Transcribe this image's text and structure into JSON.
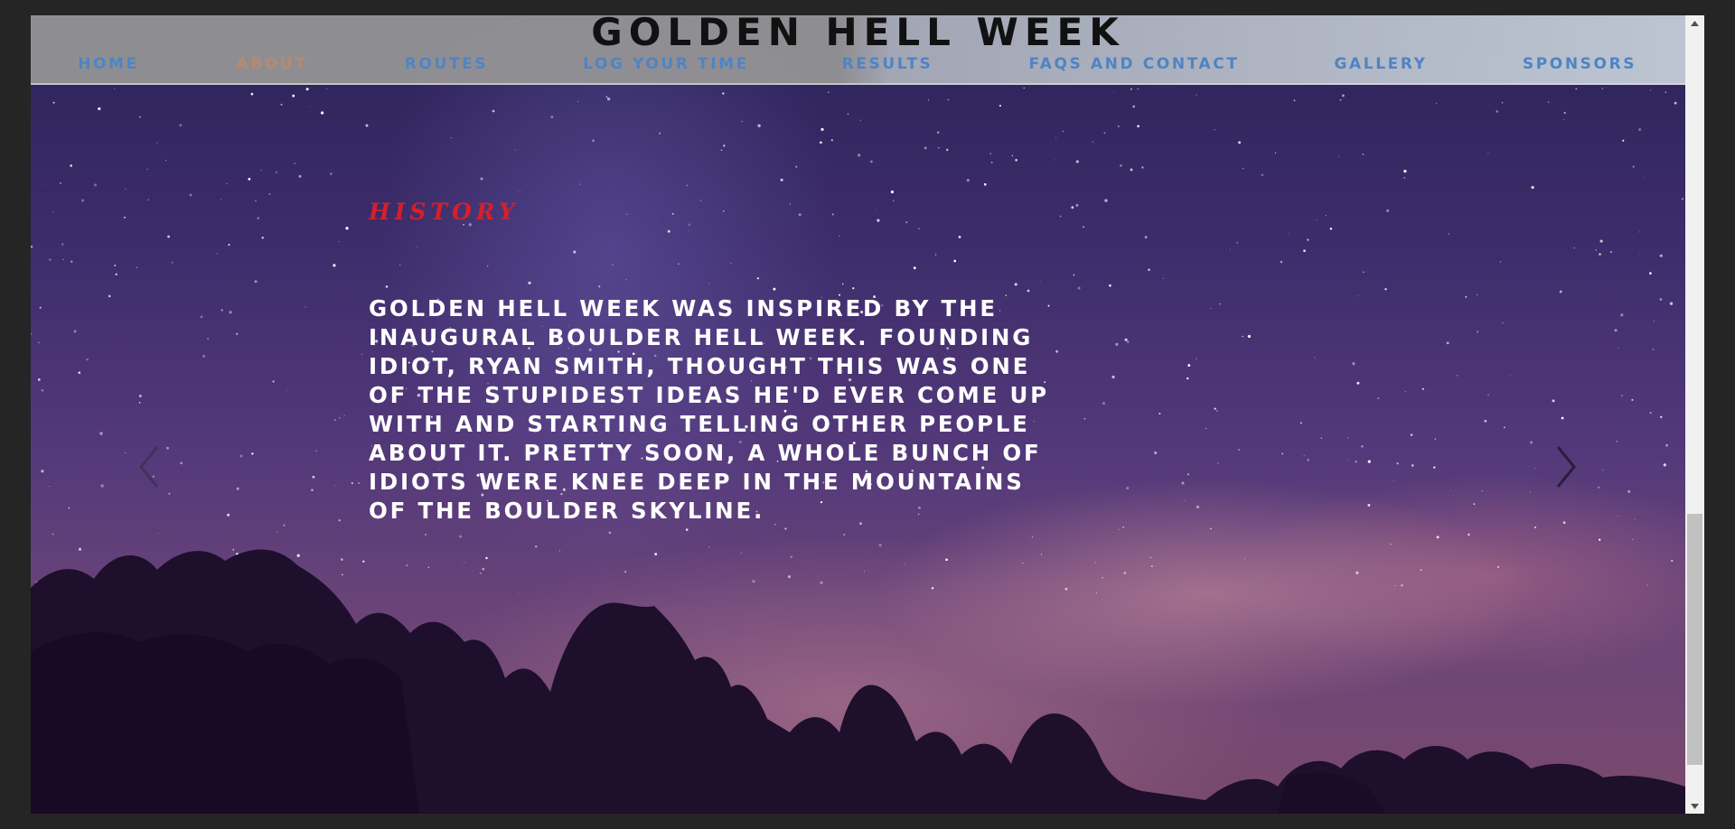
{
  "header": {
    "site_title": "GOLDEN HELL WEEK"
  },
  "nav": {
    "items": [
      {
        "label": "HOME",
        "active": false
      },
      {
        "label": "ABOUT",
        "active": true
      },
      {
        "label": "ROUTES",
        "active": false
      },
      {
        "label": "LOG YOUR TIME",
        "active": false
      },
      {
        "label": "RESULTS",
        "active": false
      },
      {
        "label": "FAQS AND CONTACT",
        "active": false
      },
      {
        "label": "GALLERY",
        "active": false
      },
      {
        "label": "SPONSORS",
        "active": false
      }
    ]
  },
  "slide": {
    "heading": "HISTORY",
    "body": "Golden Hell Week was inspired by the inaugural Boulder Hell Week. Founding idiot, Ryan Smith, thought this was one of the stupidest ideas he'd ever come up with and starting telling other people about it. Pretty soon, a whole bunch of idiots were knee deep in the mountains of the Boulder skyline.",
    "prev_icon": "chevron-left-icon",
    "next_icon": "chevron-right-icon"
  },
  "colors": {
    "nav_link": "#4f84c4",
    "nav_active": "#d6865a",
    "heading": "#d4202b",
    "body_text": "#ffffff",
    "title": "#111111"
  }
}
